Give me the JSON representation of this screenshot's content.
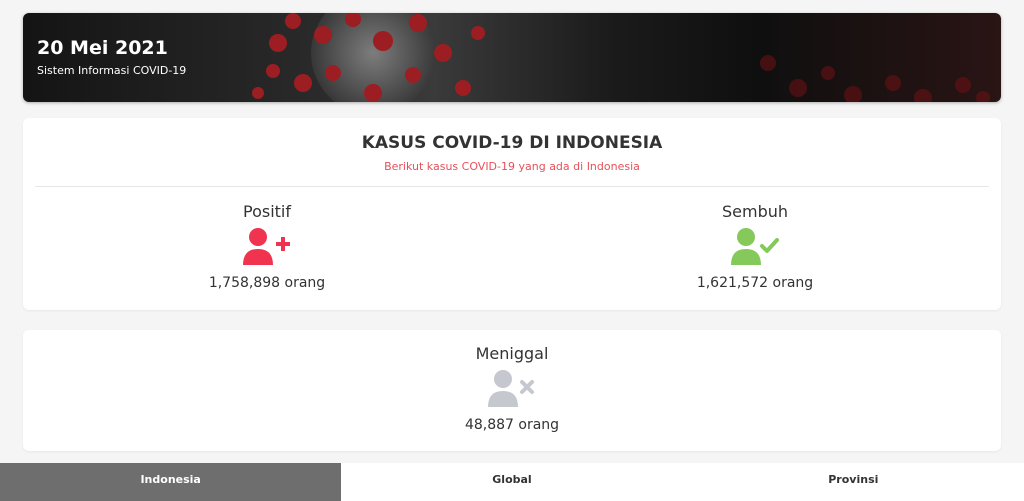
{
  "banner": {
    "date": "20 Mei 2021",
    "subtitle": "Sistem Informasi COVID-19"
  },
  "summary": {
    "title": "KASUS COVID-19 DI INDONESIA",
    "subtitle": "Berikut kasus COVID-19 yang ada di Indonesia"
  },
  "stats": {
    "positif": {
      "label": "Positif",
      "value": "1,758,898 orang",
      "icon": "user-plus-icon",
      "color": "#f0344f"
    },
    "sembuh": {
      "label": "Sembuh",
      "value": "1,621,572 orang",
      "icon": "user-check-icon",
      "color": "#86c95b"
    },
    "meninggal": {
      "label": "Meniggal",
      "value": "48,887 orang",
      "icon": "user-times-icon",
      "color": "#c5c8cf"
    }
  },
  "tabs": {
    "indonesia": "Indonesia",
    "global": "Global",
    "provinsi": "Provinsi",
    "active": "Indonesia"
  }
}
